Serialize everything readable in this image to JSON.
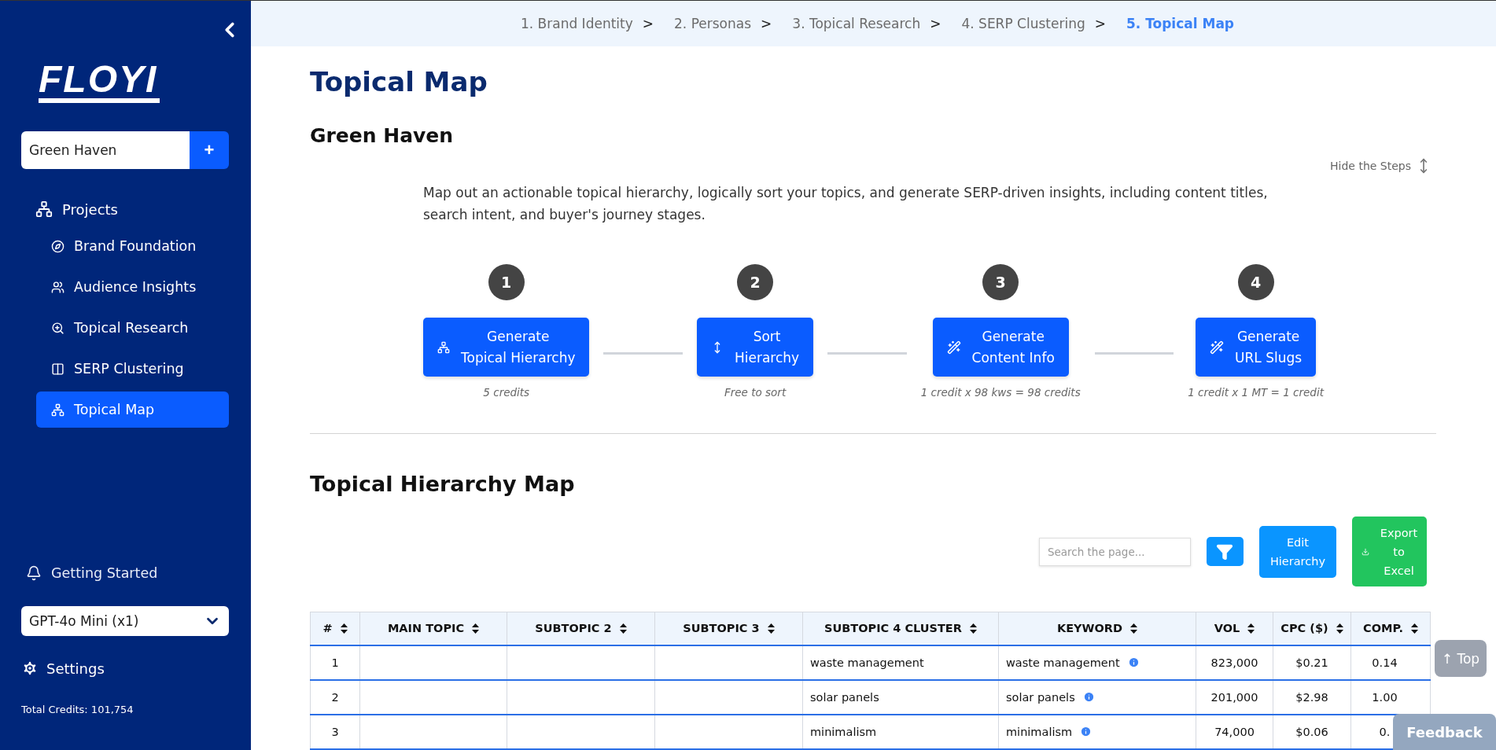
{
  "sidebar": {
    "logo": "FLOYI",
    "project_select": {
      "value": "Green Haven",
      "add_label": "+"
    },
    "nav": {
      "label": "Projects",
      "children": [
        {
          "label": "Brand Foundation",
          "selected": false
        },
        {
          "label": "Audience Insights",
          "selected": false
        },
        {
          "label": "Topical Research",
          "selected": false
        },
        {
          "label": "SERP Clustering",
          "selected": false
        },
        {
          "label": "Topical Map",
          "selected": true
        }
      ]
    },
    "getting_started": "Getting Started",
    "model_select": "GPT-4o Mini (x1)",
    "settings": "Settings",
    "credits": "Total Credits: 101,754"
  },
  "breadcrumb": [
    {
      "label": "1. Brand Identity",
      "separator": ">",
      "selected": false
    },
    {
      "label": "2. Personas",
      "separator": ">",
      "selected": false
    },
    {
      "label": "3. Topical Research",
      "separator": ">",
      "selected": false
    },
    {
      "label": "4. SERP Clustering",
      "separator": ">",
      "selected": false
    },
    {
      "label": "5. Topical Map",
      "selected": true
    }
  ],
  "page_title": "Topical Map",
  "project_name": "Green Haven",
  "hide_steps": "Hide the Steps",
  "description": "Map out an actionable topical hierarchy, logically sort your topics, and generate SERP-driven insights, including content titles, search intent, and buyer's journey stages.",
  "steps": [
    {
      "number": "1",
      "label": "Generate\nTopical Hierarchy",
      "note": "5 credits"
    },
    {
      "number": "2",
      "label": "Sort\nHierarchy",
      "note": "Free to sort"
    },
    {
      "number": "3",
      "label": "Generate\nContent Info",
      "note": "1 credit x 98 kws = 98 credits"
    },
    {
      "number": "4",
      "label": "Generate\nURL Slugs",
      "note": "1 credit x 1 MT = 1 credit"
    }
  ],
  "map_title": "Topical Hierarchy Map",
  "toolbar": {
    "search": {
      "placeholder": "Search the page..."
    },
    "edit_button": "Edit\nHierarchy",
    "export_button": "Export\nto\nExcel"
  },
  "table": {
    "columns": [
      "#",
      "MAIN TOPIC",
      "SUBTOPIC 2",
      "SUBTOPIC 3",
      "SUBTOPIC 4 CLUSTER",
      "KEYWORD",
      "VOL",
      "CPC ($)",
      "COMP."
    ],
    "rows": [
      {
        "cells": [
          "1",
          "",
          "",
          "",
          "waste management",
          "waste management",
          "823,000",
          "$0.21",
          "0.14"
        ]
      },
      {
        "cells": [
          "2",
          "",
          "",
          "",
          "solar panels",
          "solar panels",
          "201,000",
          "$2.98",
          "1.00"
        ]
      },
      {
        "cells": [
          "3",
          "",
          "",
          "",
          "minimalism",
          "minimalism",
          "74,000",
          "$0.06",
          "0."
        ]
      }
    ]
  },
  "top_button": "↑ Top",
  "feedback_button": "Feedback"
}
